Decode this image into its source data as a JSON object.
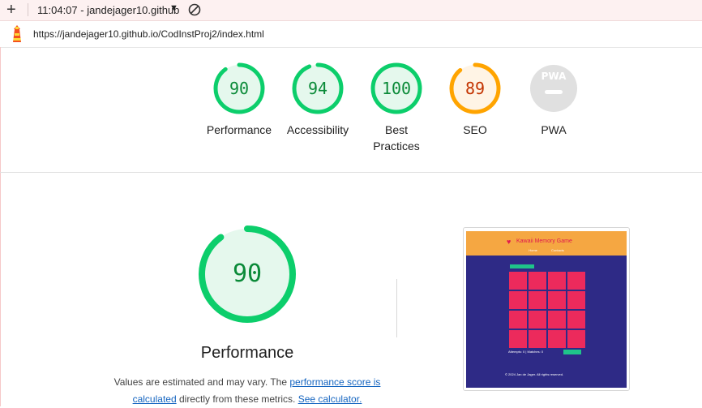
{
  "topbar": {
    "plus_icon": "plus-icon",
    "title": "11:04:07 - jandejager10.github",
    "dropdown_icon": "caret-down-icon",
    "block_icon": "block-icon"
  },
  "urlbar": {
    "logo_icon": "lighthouse-icon",
    "url": "https://jandejager10.github.io/CodInstProj2/index.html"
  },
  "gauges": [
    {
      "label": "Performance",
      "score": "90",
      "fraction": 0.9,
      "color": "#0cce6b",
      "text_color": "#0a8a38",
      "fill": "#e5f8ed"
    },
    {
      "label": "Accessibility",
      "score": "94",
      "fraction": 0.94,
      "color": "#0cce6b",
      "text_color": "#0a8a38",
      "fill": "#e5f8ed"
    },
    {
      "label": "Best Practices",
      "score": "100",
      "fraction": 1.0,
      "color": "#0cce6b",
      "text_color": "#0a8a38",
      "fill": "#e5f8ed"
    },
    {
      "label": "SEO",
      "score": "89",
      "fraction": 0.89,
      "color": "#ffa400",
      "text_color": "#c33300",
      "fill": "#fff4e5"
    },
    {
      "label": "PWA",
      "score": "",
      "fraction": 0,
      "color": "#d9d9d9",
      "text_color": "#9e9e9e",
      "fill": "#e0e0e0"
    }
  ],
  "performance": {
    "score": "90",
    "fraction": 0.9,
    "title": "Performance",
    "desc_prefix": "Values are estimated and may vary. The ",
    "link1": "performance score is calculated",
    "desc_middle": " directly from these metrics. ",
    "link2": "See calculator."
  },
  "screenshot": {
    "game_title": "Kawaii Memory Game",
    "nav_items": [
      "Home",
      "Contacts"
    ],
    "footer_stats": "Attempts: 0 | Matches: 0",
    "copyright": "© 2024 Jan de Jager. All rights reserved."
  }
}
